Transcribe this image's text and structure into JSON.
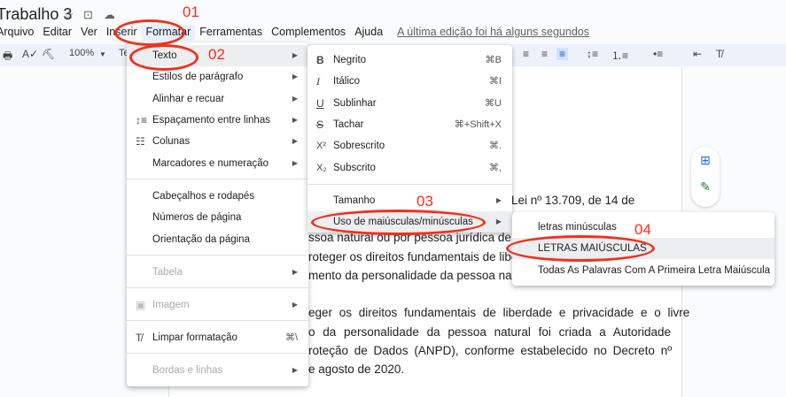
{
  "title": "Trabalho 3",
  "title_icons": [
    "star-icon",
    "move-folder-icon",
    "cloud-saved-icon"
  ],
  "menubar": {
    "items": [
      "Arquivo",
      "Editar",
      "Ver",
      "Inserir",
      "Formatar",
      "Ferramentas",
      "Complementos",
      "Ajuda"
    ],
    "last_edit": "A última edição foi há alguns segundos"
  },
  "toolbar": {
    "zoom": "100%",
    "style": "Te"
  },
  "format_menu": {
    "items": [
      {
        "label": "Texto",
        "icon": "",
        "arrow": true
      },
      {
        "label": "Estilos de parágrafo",
        "arrow": true
      },
      {
        "label": "Alinhar e recuar",
        "arrow": true
      },
      {
        "label": "Espaçamento entre linhas",
        "icon": "line-spacing-icon",
        "arrow": true
      },
      {
        "label": "Colunas",
        "icon": "columns-icon",
        "arrow": true
      },
      {
        "label": "Marcadores e numeração",
        "arrow": true
      },
      {
        "label": "Cabeçalhos e rodapés"
      },
      {
        "label": "Números de página"
      },
      {
        "label": "Orientação da página"
      },
      {
        "label": "Tabela",
        "arrow": true,
        "disabled": true
      },
      {
        "label": "Imagem",
        "icon": "image-icon",
        "arrow": true,
        "disabled": true
      },
      {
        "label": "Limpar formatação",
        "icon": "clear-format-icon",
        "shortcut": "⌘\\"
      },
      {
        "label": "Bordas e linhas",
        "arrow": true,
        "disabled": true
      }
    ]
  },
  "text_menu": {
    "items": [
      {
        "label": "Negrito",
        "icon": "B",
        "shortcut": "⌘B"
      },
      {
        "label": "Itálico",
        "icon": "I",
        "shortcut": "⌘I"
      },
      {
        "label": "Sublinhar",
        "icon": "U",
        "shortcut": "⌘U"
      },
      {
        "label": "Tachar",
        "icon": "S",
        "shortcut": "⌘+Shift+X"
      },
      {
        "label": "Sobrescrito",
        "icon": "X²",
        "shortcut": "⌘."
      },
      {
        "label": "Subscrito",
        "icon": "X₂",
        "shortcut": "⌘,"
      },
      {
        "label": "Tamanho"
      },
      {
        "label": "Uso de maiúsculas/minúsculas"
      }
    ]
  },
  "case_menu": {
    "items": [
      "letras minúsculas",
      "LETRAS MAIÚSCULAS",
      "Todas As Palavras Com A Primeira Letra Maiúscula"
    ]
  },
  "document": {
    "lines": [
      "), Lei nº 13.709, de 14 de",
      "ssoa natural ou por pessoa jurídica de direi",
      "roteger os direitos fundamentais de liberd",
      "mento da personalidade da pessoa natural",
      "eger os direitos fundamentais de liberdade e privacidade e o livre",
      "o da personalidade da pessoa natural foi criada a Autoridade",
      "roteção de Dados (ANPD), conforme estabelecido no Decreto nº",
      "e agosto de 2020."
    ]
  },
  "annotations": [
    "01",
    "02",
    "03",
    "04"
  ],
  "colors": {
    "annotation": "#f2301c",
    "menu_highlight": "#edeef0",
    "toolbar_bg": "#edf2fa"
  }
}
